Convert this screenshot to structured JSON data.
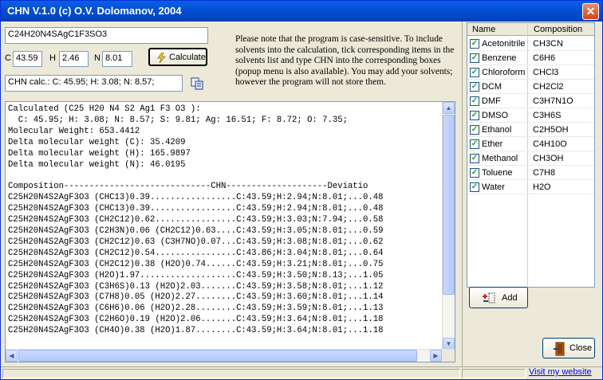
{
  "window": {
    "title": "CHN V.1.0 (c) O.V. Dolomanov, 2004",
    "close_glyph": "✕"
  },
  "formula": {
    "value": "C24H20N4SAgC1F3SO3"
  },
  "inputs": {
    "c_label": "C",
    "c_value": "43.59",
    "h_label": "H",
    "h_value": "2.46",
    "n_label": "N",
    "n_value": "8.01"
  },
  "calculate_button": {
    "label": "Calculate",
    "icon": "calculate-icon"
  },
  "calc_result": {
    "value": "CHN calc.: C: 45.95; H: 3.08; N: 8.57;"
  },
  "copy_icon": "copy-icon",
  "note": "Please note that the program is case-sensitive. To include solvents into the calculation, tick corresponding items in the solvents list and type CHN into the corresponding boxes (popup menu is also available). You may add your solvents; however the program will not store them.",
  "results": {
    "lines": [
      "Calculated (C25 H20 N4 S2 Ag1 F3 O3 ):",
      "  C: 45.95; H: 3.08; N: 8.57; S: 9.81; Ag: 16.51; F: 8.72; O: 7.35;",
      "Molecular Weight: 653.4412",
      "Delta molecular weight (C): 35.4209",
      "Delta molecular weight (H): 165.9897",
      "Delta molecular weight (N): 46.0195",
      "",
      "Composition-----------------------------CHN--------------------Deviatio",
      "C25H20N4S2AgF3O3 (CHC13)0.39.................C:43.59;H:2.94;N:8.01;...0.48",
      "C25H20N4S2AgF3O3 (CHC13)0.39.................C:43.59;H:2.94;N:8.01;...0.48",
      "C25H20N4S2AgF3O3 (CH2C12)0.62................C:43.59;H:3.03;N:7.94;...0.58",
      "C25H20N4S2AgF3O3 (C2H3N)0.06 (CH2C12)0.63....C:43.59;H:3.05;N:8.01;...0.59",
      "C25H20N4S2AgF3O3 (CH2C12)0.63 (C3H7NO)0.07...C:43.59;H:3.08;N:8.01;...0.62",
      "C25H20N4S2AgF3O3 (CH2C12)0.54................C:43.86;H:3.04;N:8.01;...0.64",
      "C25H20N4S2AgF3O3 (CH2C12)0.38 (H2O)0.74......C:43.59;H:3.21;N:8.01;...0.75",
      "C25H20N4S2AgF3O3 (H2O)1.97...................C:43.59;H:3.50;N:8.13;...1.05",
      "C25H20N4S2AgF3O3 (C3H6S)0.13 (H2O)2.03.......C:43.59;H:3.58;N:8.01;...1.12",
      "C25H20N4S2AgF3O3 (C7H8)0.05 (H2O)2.27........C:43.59;H:3.60;N:8.01;...1.14",
      "C25H20N4S2AgF3O3 (C6H6)0.06 (H2O)2.28........C:43.59;H:3.59;N:8.01;...1.13",
      "C25H20N4S2AgF3O3 (C2H6O)0.19 (H2O)2.06.......C:43.59;H:3.64;N:8.01;...1.18",
      "C25H20N4S2AgF3O3 (CH4O)0.38 (H2O)1.87........C:43.59;H:3.64;N:8.01;...1.18"
    ]
  },
  "solvents": {
    "headers": {
      "name": "Name",
      "composition": "Composition"
    },
    "items": [
      {
        "name": "Acetonitrile",
        "composition": "CH3CN",
        "checked": true
      },
      {
        "name": "Benzene",
        "composition": "C6H6",
        "checked": true
      },
      {
        "name": "Chloroform",
        "composition": "CHCl3",
        "checked": true
      },
      {
        "name": "DCM",
        "composition": "CH2Cl2",
        "checked": true
      },
      {
        "name": "DMF",
        "composition": "C3H7N1O",
        "checked": true
      },
      {
        "name": "DMSO",
        "composition": "C3H6S",
        "checked": true
      },
      {
        "name": "Ethanol",
        "composition": "C2H5OH",
        "checked": true
      },
      {
        "name": "Ether",
        "composition": "C4H10O",
        "checked": true
      },
      {
        "name": "Methanol",
        "composition": "CH3OH",
        "checked": true
      },
      {
        "name": "Toluene",
        "composition": "C7H8",
        "checked": true
      },
      {
        "name": "Water",
        "composition": "H2O",
        "checked": true
      }
    ]
  },
  "add_button": {
    "label": "Add",
    "icon": "add-icon"
  },
  "close_button": {
    "label": "Close",
    "icon": "close-door-icon"
  },
  "footer": {
    "link": "Visit my website"
  },
  "colors": {
    "title_bar": "#0a5fe5",
    "link": "#0000ee",
    "check": "#21a121"
  }
}
